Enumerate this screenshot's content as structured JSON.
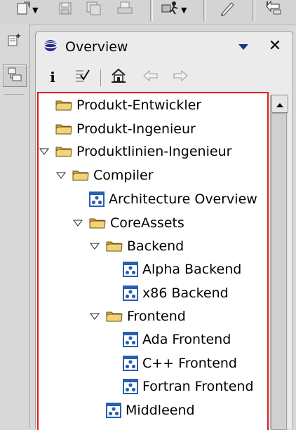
{
  "view": {
    "title": "Overview"
  },
  "tree": {
    "items": [
      {
        "label": "Produkt-Entwickler",
        "type": "folder",
        "expanded": false
      },
      {
        "label": "Produkt-Ingenieur",
        "type": "folder",
        "expanded": false
      },
      {
        "label": "Produktlinien-Ingenieur",
        "type": "folder",
        "expanded": true
      },
      {
        "label": "Compiler",
        "type": "folder",
        "expanded": true
      },
      {
        "label": "Architecture Overview",
        "type": "diagram"
      },
      {
        "label": "CoreAssets",
        "type": "folder",
        "expanded": true
      },
      {
        "label": "Backend",
        "type": "folder",
        "expanded": true
      },
      {
        "label": "Alpha Backend",
        "type": "diagram"
      },
      {
        "label": "x86 Backend",
        "type": "diagram"
      },
      {
        "label": "Frontend",
        "type": "folder",
        "expanded": true
      },
      {
        "label": "Ada Frontend",
        "type": "diagram"
      },
      {
        "label": "C++ Frontend",
        "type": "diagram"
      },
      {
        "label": "Fortran Frontend",
        "type": "diagram"
      },
      {
        "label": "Middleend",
        "type": "diagram"
      }
    ]
  },
  "colors": {
    "selection_border": "#e21a1a",
    "folder": "#e8c25a",
    "diagram": "#2a5fb0",
    "view_menu": "#1a2f8a"
  }
}
